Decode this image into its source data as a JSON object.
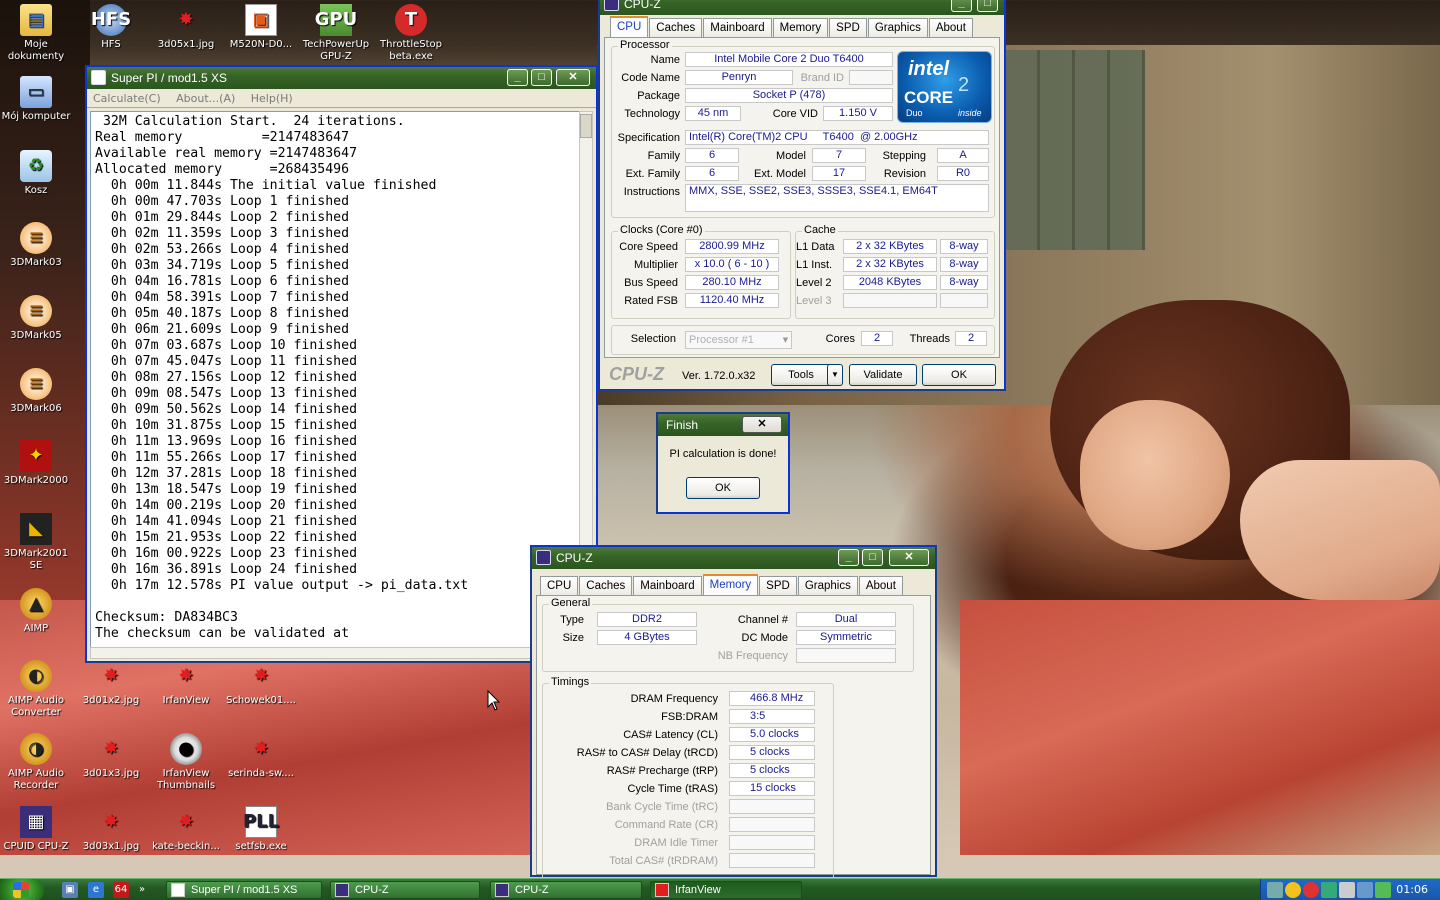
{
  "desktop_icons": [
    {
      "label": "Moje dokumenty",
      "icon": "folder-icon"
    },
    {
      "label": "HFS",
      "icon": "hfs-icon"
    },
    {
      "label": "3d05x1.jpg",
      "icon": "image-splat-icon"
    },
    {
      "label": "M520N-D0...",
      "icon": "pdf-icon"
    },
    {
      "label": "TechPowerUp GPU-Z",
      "icon": "gpu-z-icon"
    },
    {
      "label": "ThrottleStop beta.exe",
      "icon": "throttlestop-icon"
    },
    {
      "label": "Mój komputer",
      "icon": "computer-icon"
    },
    {
      "label": "Kosz",
      "icon": "recycle-bin-icon"
    },
    {
      "label": "3DMark03",
      "icon": "3dmark-icon"
    },
    {
      "label": "3DMark05",
      "icon": "3dmark-icon"
    },
    {
      "label": "3DMark06",
      "icon": "3dmark-icon"
    },
    {
      "label": "3DMark2000",
      "icon": "3dmark2000-icon"
    },
    {
      "label": "3DMark2001 SE",
      "icon": "3dmark2001-icon"
    },
    {
      "label": "AIMP",
      "icon": "aimp-icon"
    },
    {
      "label": "AIMP Audio Converter",
      "icon": "aimp-converter-icon"
    },
    {
      "label": "AIMP Audio Recorder",
      "icon": "aimp-recorder-icon"
    },
    {
      "label": "CPUID CPU-Z",
      "icon": "cpuz-icon"
    },
    {
      "label": "3d01x2.jpg",
      "icon": "image-splat-icon"
    },
    {
      "label": "IrfanView",
      "icon": "image-splat-icon"
    },
    {
      "label": "Schowek01....",
      "icon": "image-splat-icon"
    },
    {
      "label": "3d01x3.jpg",
      "icon": "image-splat-icon"
    },
    {
      "label": "IrfanView Thumbnails",
      "icon": "panda-icon"
    },
    {
      "label": "serinda-sw....",
      "icon": "image-splat-icon"
    },
    {
      "label": "3d03x1.jpg",
      "icon": "image-splat-icon"
    },
    {
      "label": "kate-beckin...",
      "icon": "image-splat-icon"
    },
    {
      "label": "setfsb.exe",
      "icon": "setfsb-icon"
    }
  ],
  "superpi": {
    "title": "Super PI / mod1.5 XS",
    "menu": [
      "Calculate(C)",
      "About...(A)",
      "Help(H)"
    ],
    "lines": [
      " 32M Calculation Start.  24 iterations.",
      "Real memory          =2147483647",
      "Available real memory =2147483647",
      "Allocated memory      =268435496",
      "  0h 00m 11.844s The initial value finished",
      "  0h 00m 47.703s Loop 1 finished",
      "  0h 01m 29.844s Loop 2 finished",
      "  0h 02m 11.359s Loop 3 finished",
      "  0h 02m 53.266s Loop 4 finished",
      "  0h 03m 34.719s Loop 5 finished",
      "  0h 04m 16.781s Loop 6 finished",
      "  0h 04m 58.391s Loop 7 finished",
      "  0h 05m 40.187s Loop 8 finished",
      "  0h 06m 21.609s Loop 9 finished",
      "  0h 07m 03.687s Loop 10 finished",
      "  0h 07m 45.047s Loop 11 finished",
      "  0h 08m 27.156s Loop 12 finished",
      "  0h 09m 08.547s Loop 13 finished",
      "  0h 09m 50.562s Loop 14 finished",
      "  0h 10m 31.875s Loop 15 finished",
      "  0h 11m 13.969s Loop 16 finished",
      "  0h 11m 55.266s Loop 17 finished",
      "  0h 12m 37.281s Loop 18 finished",
      "  0h 13m 18.547s Loop 19 finished",
      "  0h 14m 00.219s Loop 20 finished",
      "  0h 14m 41.094s Loop 21 finished",
      "  0h 15m 21.953s Loop 22 finished",
      "  0h 16m 00.922s Loop 23 finished",
      "  0h 16m 36.891s Loop 24 finished",
      "  0h 17m 12.578s PI value output -> pi_data.txt",
      "",
      "Checksum: DA834BC3",
      "The checksum can be validated at"
    ]
  },
  "cpuz_top": {
    "title": "CPU-Z",
    "tabs": [
      "CPU",
      "Caches",
      "Mainboard",
      "Memory",
      "SPD",
      "Graphics",
      "About"
    ],
    "active_tab": "CPU",
    "processor_group": "Processor",
    "name_label": "Name",
    "name": "Intel Mobile Core 2 Duo T6400",
    "codename_label": "Code Name",
    "codename": "Penryn",
    "brandid_label": "Brand ID",
    "brandid": "",
    "package_label": "Package",
    "package": "Socket P (478)",
    "technology_label": "Technology",
    "technology": "45 nm",
    "corevid_label": "Core VID",
    "corevid": "1.150 V",
    "spec_label": "Specification",
    "spec": "Intel(R) Core(TM)2 CPU     T6400  @ 2.00GHz",
    "family_label": "Family",
    "family": "6",
    "model_label": "Model",
    "model": "7",
    "stepping_label": "Stepping",
    "stepping": "A",
    "extfamily_label": "Ext. Family",
    "extfamily": "6",
    "extmodel_label": "Ext. Model",
    "extmodel": "17",
    "revision_label": "Revision",
    "revision": "R0",
    "instructions_label": "Instructions",
    "instructions": "MMX, SSE, SSE2, SSE3, SSSE3, SSE4.1, EM64T",
    "logo": {
      "line1": "intel",
      "line2": "CORE",
      "line3": "Duo",
      "line4": "inside",
      "superscript": "2"
    },
    "clocks_group": "Clocks (Core #0)",
    "corespeed_label": "Core Speed",
    "corespeed": "2800.99 MHz",
    "multiplier_label": "Multiplier",
    "multiplier": "x 10.0 ( 6 - 10 )",
    "busspeed_label": "Bus Speed",
    "busspeed": "280.10 MHz",
    "ratedfsb_label": "Rated FSB",
    "ratedfsb": "1120.40 MHz",
    "cache_group": "Cache",
    "l1data_label": "L1 Data",
    "l1data": "2 x 32 KBytes",
    "l1data_way": "8-way",
    "l1inst_label": "L1 Inst.",
    "l1inst": "2 x 32 KBytes",
    "l1inst_way": "8-way",
    "level2_label": "Level 2",
    "level2": "2048 KBytes",
    "level2_way": "8-way",
    "level3_label": "Level 3",
    "selection_label": "Selection",
    "selection": "Processor #1",
    "cores_label": "Cores",
    "cores": "2",
    "threads_label": "Threads",
    "threads": "2",
    "brand": "CPU-Z",
    "version": "Ver. 1.72.0.x32",
    "tools_btn": "Tools",
    "validate_btn": "Validate",
    "ok_btn": "OK"
  },
  "finish": {
    "title": "Finish",
    "message": "PI calculation is done!",
    "ok": "OK"
  },
  "cpuz_mem": {
    "title": "CPU-Z",
    "tabs": [
      "CPU",
      "Caches",
      "Mainboard",
      "Memory",
      "SPD",
      "Graphics",
      "About"
    ],
    "active_tab": "Memory",
    "general_group": "General",
    "type_label": "Type",
    "type": "DDR2",
    "size_label": "Size",
    "size": "4 GBytes",
    "channel_label": "Channel #",
    "channel": "Dual",
    "dcmode_label": "DC Mode",
    "dcmode": "Symmetric",
    "nbfreq_label": "NB Frequency",
    "timings_group": "Timings",
    "timings": [
      {
        "label": "DRAM Frequency",
        "value": "466.8 MHz",
        "dim": false
      },
      {
        "label": "FSB:DRAM",
        "value": "3:5",
        "dim": false
      },
      {
        "label": "CAS# Latency (CL)",
        "value": "5.0 clocks",
        "dim": false
      },
      {
        "label": "RAS# to CAS# Delay (tRCD)",
        "value": "5 clocks",
        "dim": false
      },
      {
        "label": "RAS# Precharge (tRP)",
        "value": "5 clocks",
        "dim": false
      },
      {
        "label": "Cycle Time (tRAS)",
        "value": "15 clocks",
        "dim": false
      },
      {
        "label": "Bank Cycle Time (tRC)",
        "value": "",
        "dim": true
      },
      {
        "label": "Command Rate (CR)",
        "value": "",
        "dim": true
      },
      {
        "label": "DRAM Idle Timer",
        "value": "",
        "dim": true
      },
      {
        "label": "Total CAS# (tRDRAM)",
        "value": "",
        "dim": true
      }
    ]
  },
  "taskbar": {
    "items": [
      {
        "label": "Super PI / mod1.5 XS",
        "active": false
      },
      {
        "label": "CPU-Z",
        "active": false
      },
      {
        "label": "CPU-Z",
        "active": false
      },
      {
        "label": "IrfanView",
        "active": true
      }
    ],
    "quicklaunch_badge": "64",
    "quicklaunch_more": "»",
    "clock": "01:06"
  },
  "colors": {
    "xp_green_title": "#376428",
    "cpuz_value_text": "#1a1a90",
    "tray_blue": "#1f6ac7"
  }
}
